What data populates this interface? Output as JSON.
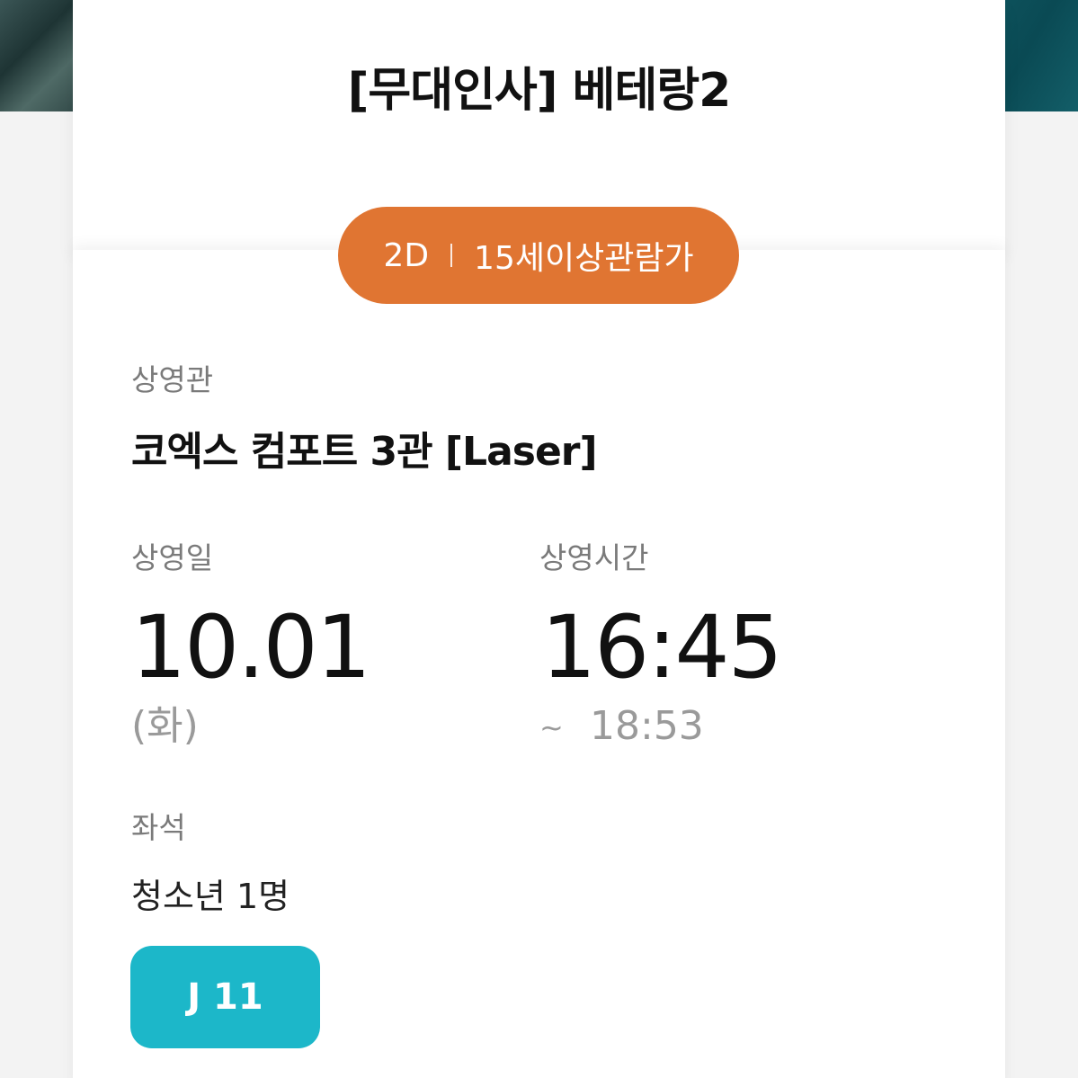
{
  "ticket": {
    "title": "[무대인사] 베테랑2",
    "format": "2D",
    "rating": "15세이상관람가"
  },
  "theater": {
    "label": "상영관",
    "value": "코엑스 컴포트 3관 [Laser]"
  },
  "date": {
    "label": "상영일",
    "value": "10.01",
    "weekday": "(화)"
  },
  "time": {
    "label": "상영시간",
    "start": "16:45",
    "tilde": "~",
    "end": "18:53"
  },
  "seat": {
    "label": "좌석",
    "audience": "청소년 1명",
    "number": "J 11"
  },
  "colors": {
    "format_pill": "#e07532",
    "seat_button": "#1cb7c9"
  }
}
